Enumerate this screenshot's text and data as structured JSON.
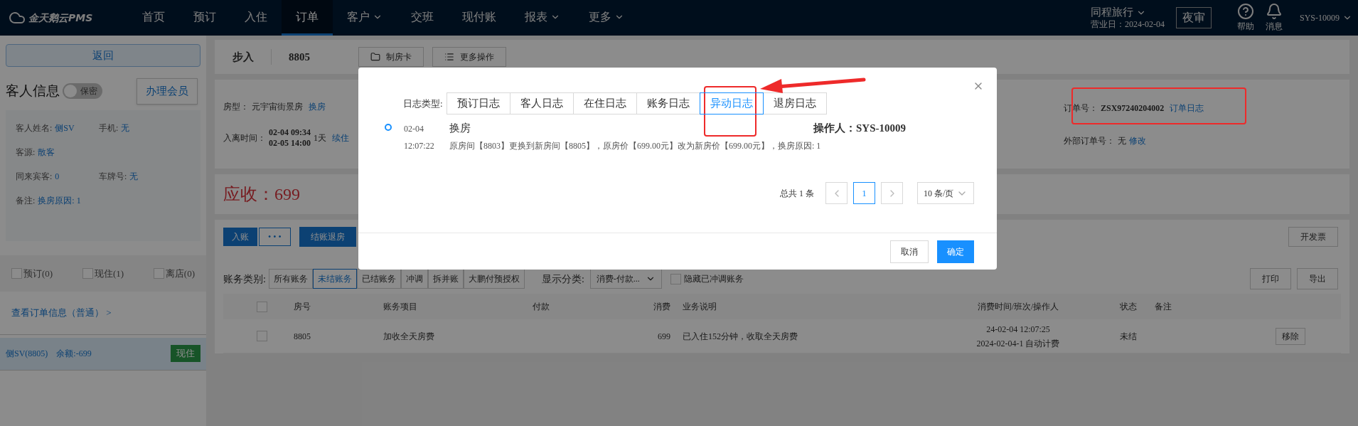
{
  "topbar": {
    "logo": "金天鹅云PMS",
    "nav": [
      {
        "label": "首页",
        "selected": false,
        "dropdown": false
      },
      {
        "label": "预订",
        "selected": false,
        "dropdown": false
      },
      {
        "label": "入住",
        "selected": false,
        "dropdown": false
      },
      {
        "label": "订单",
        "selected": true,
        "dropdown": false
      },
      {
        "label": "客户",
        "selected": false,
        "dropdown": true
      },
      {
        "label": "交班",
        "selected": false,
        "dropdown": false
      },
      {
        "label": "现付账",
        "selected": false,
        "dropdown": false
      },
      {
        "label": "报表",
        "selected": false,
        "dropdown": true
      },
      {
        "label": "更多",
        "selected": false,
        "dropdown": true
      }
    ],
    "hotel": "同程旅行",
    "business_day": "营业日：2024-02-04",
    "night_audit": "夜审",
    "help": "帮助",
    "messages": "消息",
    "user": "SYS-10009"
  },
  "sidebar": {
    "back": "返回",
    "guest_title": "客人信息",
    "privacy_toggle": {
      "label": "保密",
      "on": false
    },
    "member_button": "办理会员",
    "field_rows": [
      [
        {
          "label": "客人姓名:",
          "value": "侧SV"
        },
        {
          "label": "手机:",
          "value": "无"
        }
      ],
      [
        {
          "label": "客源:",
          "value": "散客"
        }
      ],
      [
        {
          "label": "同来宾客:",
          "value": "0"
        },
        {
          "label": "车牌号:",
          "value": "无"
        }
      ],
      [
        {
          "label": "备注:",
          "value": "换房原因: 1"
        }
      ]
    ],
    "filters": [
      {
        "label": "预订(0)",
        "checked": false
      },
      {
        "label": "现住(1)",
        "checked": false
      },
      {
        "label": "离店(0)",
        "checked": false
      }
    ],
    "order_link": "查看订单信息（普通） >",
    "guest_row": {
      "name": "侧SV(8805)",
      "balance": "余额:-699",
      "status": "现住"
    }
  },
  "order_header": {
    "source": "步入",
    "room": "8805",
    "buttons": [
      {
        "label": "制房卡"
      },
      {
        "label": "更多操作"
      }
    ]
  },
  "order_info": {
    "room_type_label": "房型：",
    "room_type": "元宇宙街景房",
    "change_room": "换房",
    "stay_label": "入离时间：",
    "check_in": "02-04 09:34",
    "check_out": "02-05 14:00",
    "nights": "1天",
    "extend": "续住",
    "order_no_label": "订单号：",
    "order_no": "ZSX97240204002",
    "order_log": "订单日志",
    "external_label": "外部订单号：",
    "external_no": "无",
    "edit": "修改"
  },
  "receivable": {
    "label": "应收：",
    "amount": "699"
  },
  "bills": {
    "post": "入账",
    "more": "• • •",
    "checkout": "结账退房",
    "invoice": "开发票",
    "category_label": "账务类别:",
    "categories": [
      {
        "label": "所有账务",
        "selected": false
      },
      {
        "label": "未结账务",
        "selected": true
      },
      {
        "label": "已结账务",
        "selected": false
      },
      {
        "label": "冲调",
        "selected": false
      },
      {
        "label": "拆并账",
        "selected": false
      },
      {
        "label": "大鹏付预授权",
        "selected": false
      }
    ],
    "display_label": "显示分类:",
    "display_value": "消费-付款...",
    "hide_adjusted": {
      "label": "隐藏已冲调账务",
      "checked": false
    },
    "print": "打印",
    "export": "导出",
    "columns": [
      "房号",
      "账务项目",
      "付款",
      "消费",
      "业务说明",
      "消费时间/班次/操作人",
      "状态",
      "备注"
    ],
    "header_checked": false,
    "rows": [
      {
        "checked": false,
        "room": "8805",
        "item": "加收全天房费",
        "payment": "",
        "amount": "699",
        "description": "已入住152分钟，收取全天房费",
        "time": "24-02-04 12:07:25",
        "shift": "2024-02-04-1 自动计费",
        "status": "未结",
        "action": "移除"
      }
    ]
  },
  "modal": {
    "type_label": "日志类型:",
    "tabs": [
      {
        "label": "预订日志",
        "selected": false
      },
      {
        "label": "客人日志",
        "selected": false
      },
      {
        "label": "在住日志",
        "selected": false
      },
      {
        "label": "账务日志",
        "selected": false
      },
      {
        "label": "异动日志",
        "selected": true
      },
      {
        "label": "退房日志",
        "selected": false
      }
    ],
    "entries": [
      {
        "date": "02-04",
        "time": "12:07:22",
        "title": "换房",
        "operator": "操作人：SYS-10009",
        "detail": "原房间【8803】更换到新房间【8805】，原房价【699.00元】改为新房价【699.00元】，换房原因: 1"
      }
    ],
    "total": "总共 1 条",
    "pages": [
      {
        "label": "1",
        "selected": true
      }
    ],
    "page_size": "10 条/页",
    "cancel": "取消",
    "ok": "确定"
  }
}
